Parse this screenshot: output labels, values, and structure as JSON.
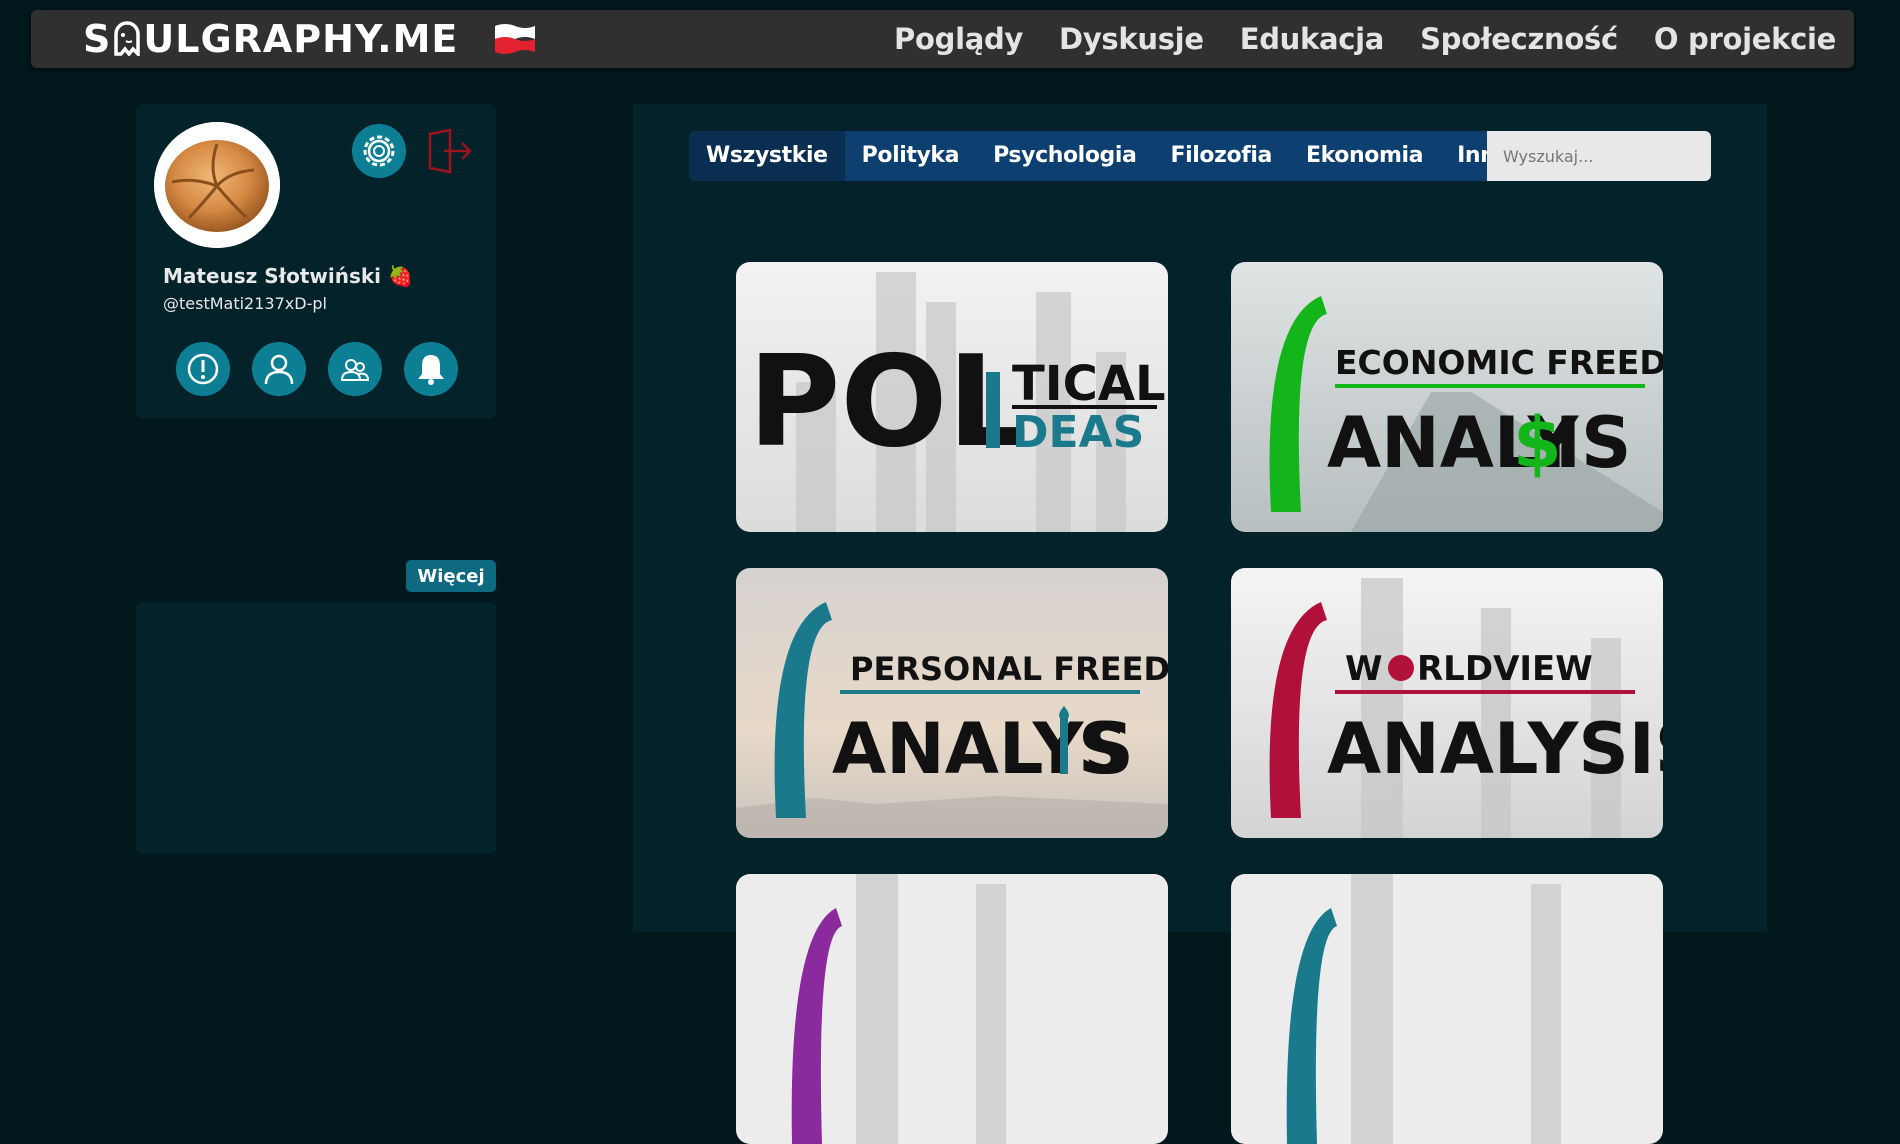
{
  "brand": {
    "logo_pre": "S",
    "logo_post": "ULGRAPHY.ME"
  },
  "nav": {
    "items": [
      "Poglądy",
      "Dyskusje",
      "Edukacja",
      "Społeczność",
      "O projekcie"
    ]
  },
  "profile": {
    "name": "Mateusz Słotwiński 🍓",
    "handle": "@testMati2137xD-pl"
  },
  "sidebar": {
    "more_label": "Więcej"
  },
  "filters": {
    "tabs": [
      "Wszystkie",
      "Polityka",
      "Psychologia",
      "Filozofia",
      "Ekonomia",
      "Inne"
    ],
    "active": "Wszystkie",
    "search_placeholder": "Wyszukaj..."
  },
  "tiles": [
    {
      "line1": "POL",
      "line2a": "TICAL",
      "line2b": "DEAS"
    },
    {
      "top": "ECONOMIC FREEDOM",
      "bottom_pre": "ANALY",
      "bottom_mark": "$",
      "bottom_post": "IS"
    },
    {
      "top": "PERSONAL FREEDOM",
      "bottom_pre": "ANALYS",
      "bottom_post": "S"
    },
    {
      "top_pre": "W",
      "top_post": "RLDVIEW",
      "bottom": "ANALYSIS"
    }
  ],
  "colors": {
    "page_bg": "#01181d",
    "panel_bg": "#03222a",
    "navbar_bg": "#303030",
    "accent": "#0d7f95",
    "filter_bg": "#0d4070",
    "teal": "#1a7a8c",
    "green": "#14b51a",
    "crimson": "#b0103a",
    "purple": "#8a2a9c"
  }
}
